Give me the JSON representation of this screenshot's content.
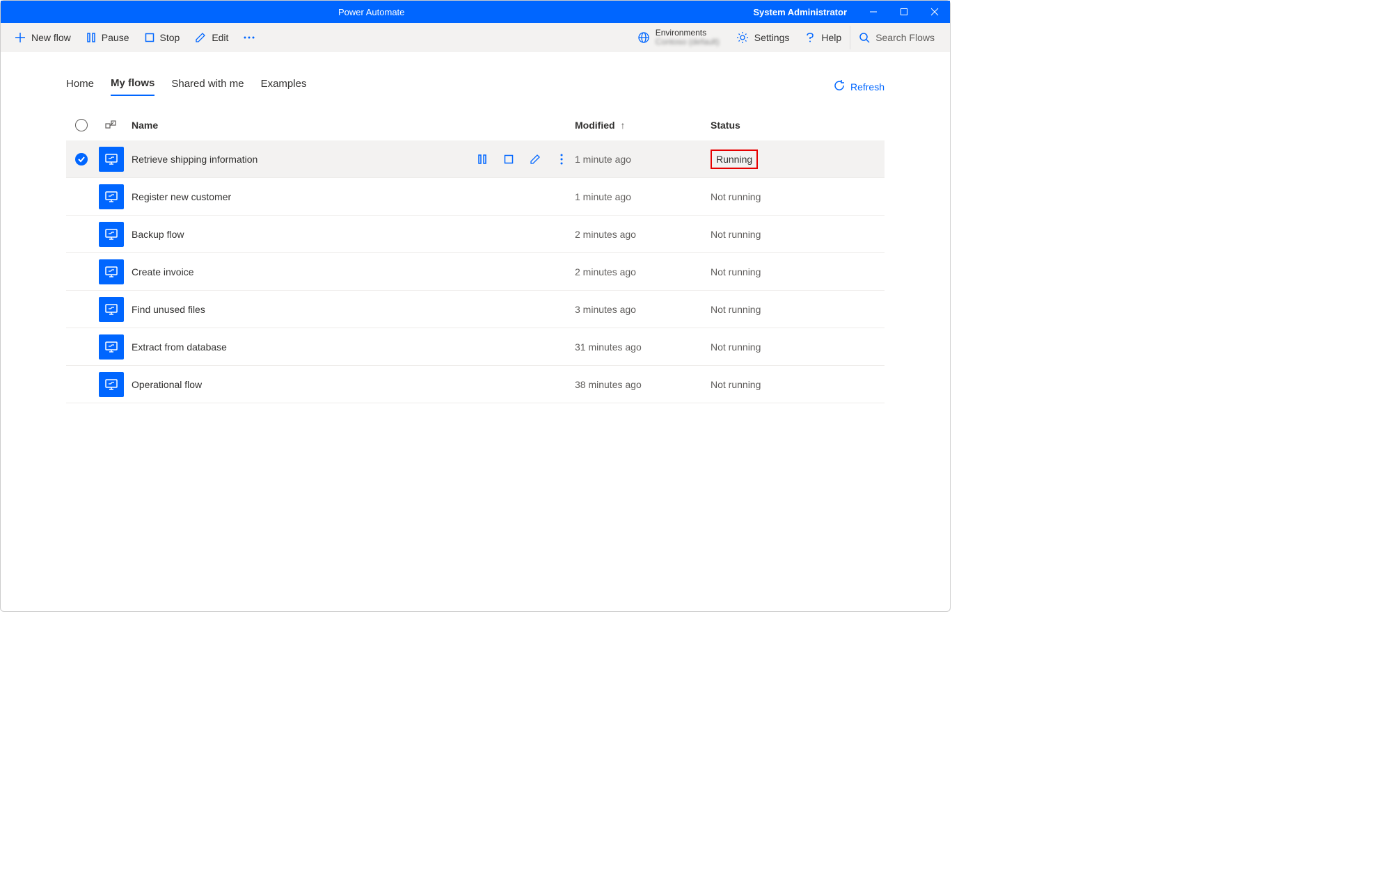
{
  "titlebar": {
    "title": "Power Automate",
    "user": "System Administrator"
  },
  "toolbar": {
    "newFlow": "New flow",
    "pause": "Pause",
    "stop": "Stop",
    "edit": "Edit",
    "environments": "Environments",
    "envValue": "Contoso (default)",
    "settings": "Settings",
    "help": "Help",
    "searchPlaceholder": "Search Flows"
  },
  "tabs": {
    "home": "Home",
    "myFlows": "My flows",
    "shared": "Shared with me",
    "examples": "Examples",
    "refresh": "Refresh"
  },
  "columns": {
    "name": "Name",
    "modified": "Modified",
    "status": "Status"
  },
  "rows": [
    {
      "name": "Retrieve shipping information",
      "modified": "1 minute ago",
      "status": "Running",
      "selected": true,
      "highlight": true
    },
    {
      "name": "Register new customer",
      "modified": "1 minute ago",
      "status": "Not running"
    },
    {
      "name": "Backup flow",
      "modified": "2 minutes ago",
      "status": "Not running"
    },
    {
      "name": "Create invoice",
      "modified": "2 minutes ago",
      "status": "Not running"
    },
    {
      "name": "Find unused files",
      "modified": "3 minutes ago",
      "status": "Not running"
    },
    {
      "name": "Extract from database",
      "modified": "31 minutes ago",
      "status": "Not running"
    },
    {
      "name": "Operational flow",
      "modified": "38 minutes ago",
      "status": "Not running"
    }
  ]
}
